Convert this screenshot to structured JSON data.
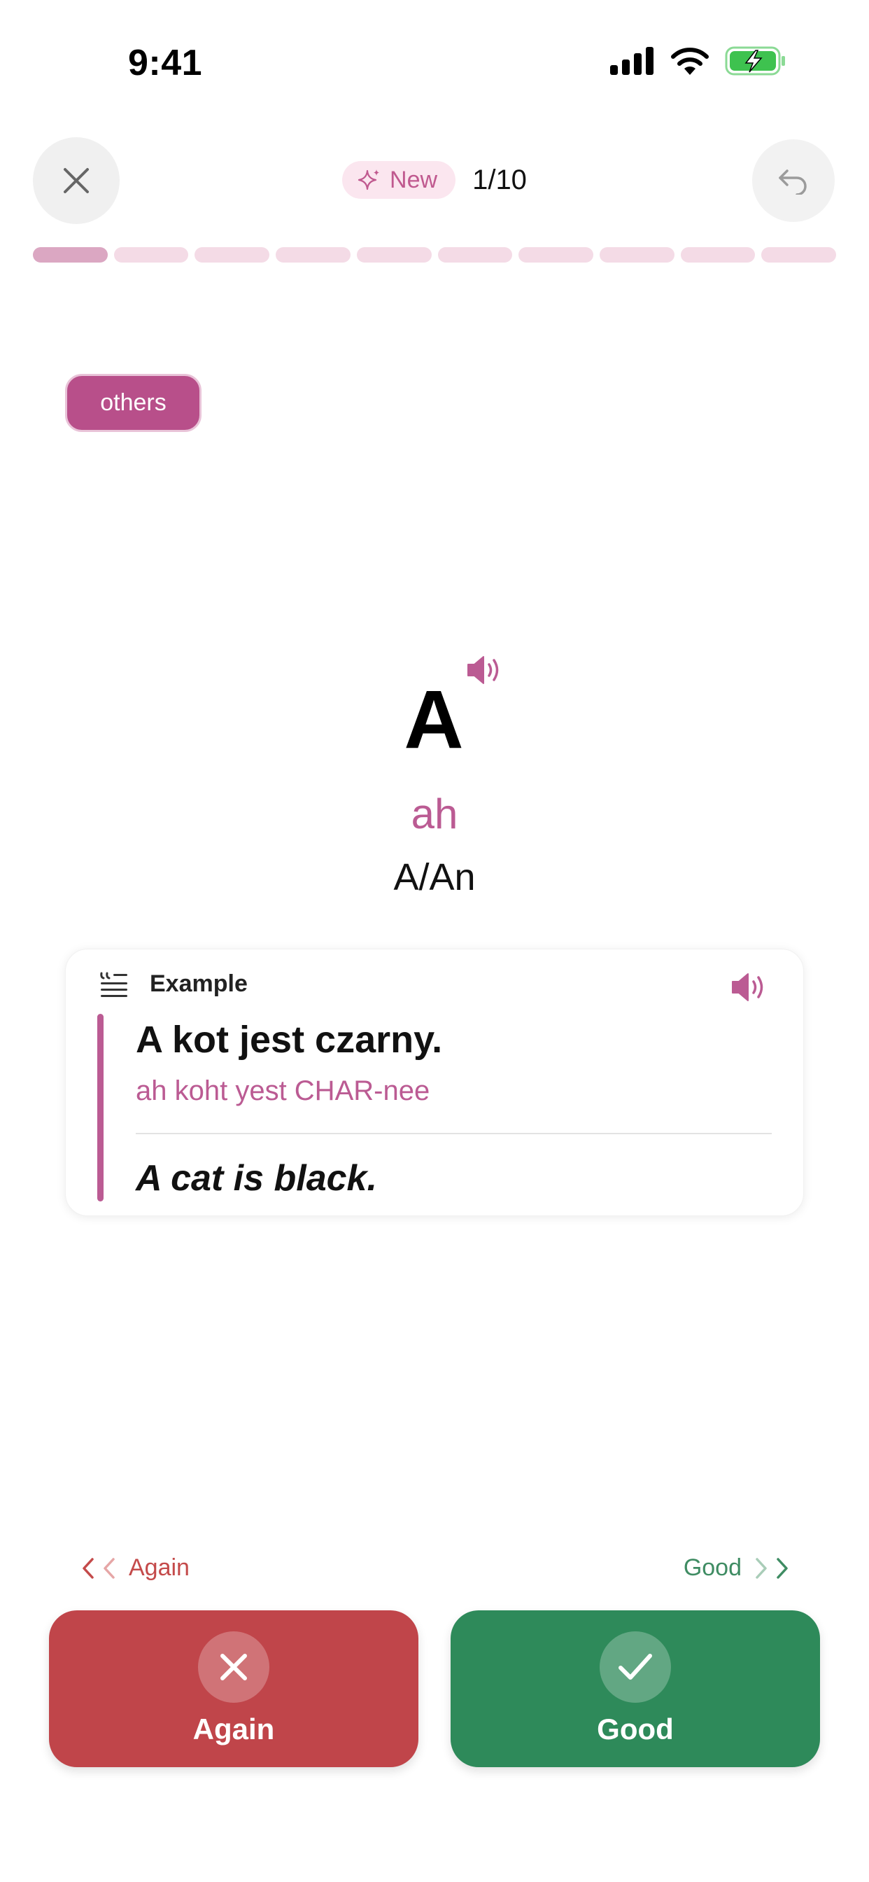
{
  "status_bar": {
    "time": "9:41"
  },
  "header": {
    "new_label": "New",
    "counter": "1/10",
    "progress": {
      "current": 1,
      "total": 10
    }
  },
  "tag": "others",
  "card": {
    "word": "A",
    "pronunciation": "ah",
    "meaning": "A/An"
  },
  "example": {
    "title": "Example",
    "sentence": "A kot jest czarny.",
    "pronunciation": "ah koht yest CHAR-nee",
    "translation": "A cat is black."
  },
  "hints": {
    "left": "Again",
    "right": "Good"
  },
  "actions": {
    "again": "Again",
    "good": "Good"
  },
  "colors": {
    "accent": "#bb5b93",
    "again": "#c0454a",
    "good": "#2e8a5a",
    "battery": "#3ec24f"
  }
}
